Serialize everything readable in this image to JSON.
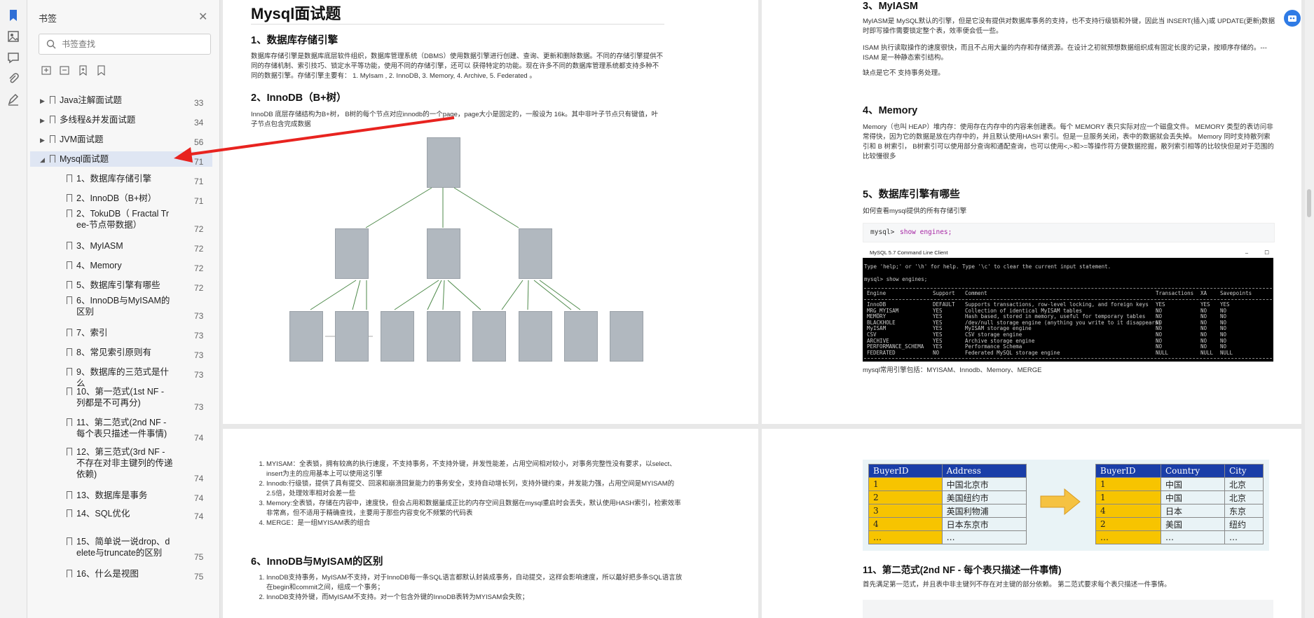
{
  "sidebar": {
    "title": "书签",
    "search_placeholder": "书签查找",
    "items": [
      {
        "label": "Java注解面试题",
        "page": "33",
        "level": 0
      },
      {
        "label": "多线程&并发面试题",
        "page": "34",
        "level": 0
      },
      {
        "label": "JVM面试题",
        "page": "56",
        "level": 0
      },
      {
        "label": "Mysql面试题",
        "page": "71",
        "level": 0,
        "expanded": true,
        "selected": true
      },
      {
        "label": "1、数据库存储引擎",
        "page": "71",
        "level": 1
      },
      {
        "label": "2、InnoDB（B+树）",
        "page": "71",
        "level": 1
      },
      {
        "label": "2、TokuDB（ Fractal Tr\nee-节点带数据）",
        "page": "72",
        "level": 1
      },
      {
        "label": "3、MyIASM",
        "page": "72",
        "level": 1
      },
      {
        "label": "4、Memory",
        "page": "72",
        "level": 1
      },
      {
        "label": "5、数据库引擎有哪些",
        "page": "72",
        "level": 1
      },
      {
        "label": "6、InnoDB与MyISAM的\n区别",
        "page": "73",
        "level": 1
      },
      {
        "label": "7、索引",
        "page": "73",
        "level": 1
      },
      {
        "label": "8、常见索引原则有",
        "page": "73",
        "level": 1
      },
      {
        "label": "9、数据库的三范式是什么",
        "page": "73",
        "level": 1
      },
      {
        "label": "10、第一范式(1st NF -\n列都是不可再分)",
        "page": "73",
        "level": 1
      },
      {
        "label": "11、第二范式(2nd NF -\n每个表只描述一件事情)",
        "page": "74",
        "level": 1
      },
      {
        "label": "12、第三范式(3rd NF -\n不存在对非主键列的传递\n依赖)",
        "page": "74",
        "level": 1
      },
      {
        "label": "13、数据库是事务",
        "page": "74",
        "level": 1
      },
      {
        "label": "14、SQL优化",
        "page": "74",
        "level": 1
      },
      {
        "label": "15、简单说一说drop、d\nelete与truncate的区别",
        "page": "75",
        "level": 1
      },
      {
        "label": "16、什么是视图",
        "page": "75",
        "level": 1
      }
    ]
  },
  "doc": {
    "page1": {
      "title": "Mysql面试题",
      "s1_heading": "1、数据库存储引擎",
      "s1_text": "数据库存储引擎是数据库底层软件组织，数据库管理系统（DBMS）使用数据引擎进行创建、查询、更新和删除数据。不同的存储引擎提供不同的存储机制、索引技巧、锁定水平等功能，使用不同的存储引擎，还可以 获得特定的功能。现在许多不同的数据库管理系统都支持多种不同的数据引擎。存储引擎主要有： 1. MyIsam , 2. InnoDB, 3. Memory, 4. Archive, 5. Federated 。",
      "s2_heading": "2、InnoDB（B+树）",
      "s2_text": "InnoDB 底层存储结构为B+树， B树的每个节点对应innodb的一个page，page大小是固定的，一般设为 16k。其中非叶子节点只有键值，叶子节点包含完成数据"
    },
    "page2": {
      "s3_heading": "3、MyIASM",
      "s3_text1": "MyIASM是 MySQL默认的引擎，但是它没有提供对数据库事务的支持，也不支持行级锁和外键，因此当 INSERT(插入)或 UPDATE(更新)数据时即写操作需要锁定整个表，效率便会低一些。",
      "s3_text2": "ISAM 执行读取操作的速度很快，而且不占用大量的内存和存储资源。在设计之初就预想数据组织成有固定长度的记录，按顺序存储的。---ISAM 是一种静态索引结构。",
      "s3_text3": "缺点是它不 支持事务处理。",
      "s4_heading": "4、Memory",
      "s4_text": "Memory（也叫 HEAP）堆内存：使用存在内存中的内容来创建表。每个 MEMORY 表只实际对应一个磁盘文件。 MEMORY 类型的表访问非常得快，因为它的数据是放在内存中的，并且默认使用HASH 索引。但是一旦服务关闭，表中的数据就会丢失掉。 Memory 同时支持散列索引和 B 树索引， B树索引可以使用部分查询和通配查询，也可以使用<,>和>=等操作符方便数据挖掘，散列索引相等的比较快但是对于范围的比较慢很多",
      "s5_heading": "5、数据库引擎有哪些",
      "s5_text": "如何查看mysql提供的所有存储引擎",
      "code_prompt": "mysql>",
      "code_cmd": "show engines;",
      "console_title": "MySQL 5.7 Command Line Client",
      "console_line1": "Type 'help;' or '\\h' for help. Type '\\c' to clear the current input statement.",
      "console_line2": "mysql> show engines;",
      "console_headers": [
        "Engine",
        "Support",
        "Comment",
        "Transactions",
        "XA",
        "Savepoints"
      ],
      "console_rows": [
        [
          "InnoDB",
          "DEFAULT",
          "Supports transactions, row-level locking, and foreign keys",
          "YES",
          "YES",
          "YES"
        ],
        [
          "MRG_MYISAM",
          "YES",
          "Collection of identical MyISAM tables",
          "NO",
          "NO",
          "NO"
        ],
        [
          "MEMORY",
          "YES",
          "Hash based, stored in memory, useful for temporary tables",
          "NO",
          "NO",
          "NO"
        ],
        [
          "BLACKHOLE",
          "YES",
          "/dev/null storage engine (anything you write to it disappears)",
          "NO",
          "NO",
          "NO"
        ],
        [
          "MyISAM",
          "YES",
          "MyISAM storage engine",
          "NO",
          "NO",
          "NO"
        ],
        [
          "CSV",
          "YES",
          "CSV storage engine",
          "NO",
          "NO",
          "NO"
        ],
        [
          "ARCHIVE",
          "YES",
          "Archive storage engine",
          "NO",
          "NO",
          "NO"
        ],
        [
          "PERFORMANCE_SCHEMA",
          "YES",
          "Performance Schema",
          "NO",
          "NO",
          "NO"
        ],
        [
          "FEDERATED",
          "NO",
          "Federated MySQL storage engine",
          "NULL",
          "NULL",
          "NULL"
        ]
      ],
      "s5_after": "mysql常用引擎包括：MYISAM、Innodb、Memory、MERGE"
    },
    "page3": {
      "list": [
        "MYISAM：全表锁，拥有较高的执行速度，不支持事务，不支持外键，并发性能差，占用空间相对较小，对事务完整性没有要求，以select、insert为主的应用基本上可以使用这引擎",
        "Innodb:行级锁，提供了具有提交、回滚和崩溃回复能力的事务安全，支持自动增长列，支持外键约束，并发能力强，占用空间是MYISAM的2.5倍，处理效率相对会差一些",
        "Memory:全表锁，存储在内容中，速度快，但会占用和数据量成正比的内存空间且数据在mysql重启时会丢失，默认使用HASH索引，检索效率非常高，但不适用于精确查找，主要用于那些内容变化不频繁的代码表",
        "MERGE：是一组MYISAM表的组合"
      ],
      "s6_heading": "6、InnoDB与MyISAM的区别",
      "s6_list": [
        "InnoDB支持事务，MyISAM不支持，对于InnoDB每一条SQL语言都默认封装成事务，自动提交，这样会影响速度，所以最好把多条SQL语言放在begin和commit之间，组成一个事务；",
        "InnoDB支持外键，而MyISAM不支持。对一个包含外键的InnoDB表转为MYISAM会失败；"
      ]
    },
    "page4": {
      "left_table": {
        "headers": [
          "BuyerID",
          "Address"
        ],
        "rows": [
          [
            "1",
            "中国北京市"
          ],
          [
            "2",
            " 美国纽约市"
          ],
          [
            "3",
            "英国利物浦"
          ],
          [
            "4",
            "日本东京市"
          ],
          [
            "…",
            "…"
          ]
        ]
      },
      "right_table": {
        "headers": [
          "BuyerID",
          "Country",
          "City"
        ],
        "rows": [
          [
            "1",
            "中国",
            "北京"
          ],
          [
            "1",
            "中国",
            "北京"
          ],
          [
            "4",
            "日本",
            "东京"
          ],
          [
            "2",
            "美国",
            "纽约"
          ],
          [
            "…",
            "…",
            "…"
          ]
        ]
      },
      "s11_heading": "11、第二范式(2nd NF - 每个表只描述一件事情)",
      "s11_text": "首先满足第一范式，并且表中非主键列不存在对主键的部分依赖。 第二范式要求每个表只描述一件事情。"
    }
  },
  "colors": {
    "accent_arrow": "#e8231f",
    "selected_bg": "#dfe6f3",
    "table_header": "#1a3ea8",
    "table_key": "#f7c400"
  }
}
